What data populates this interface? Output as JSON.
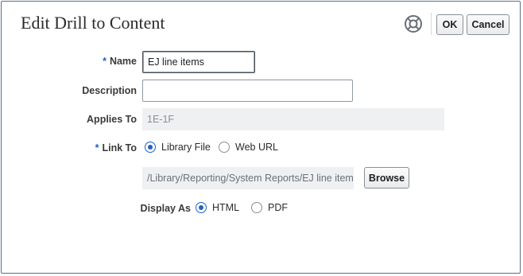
{
  "dialog": {
    "title": "Edit Drill to Content",
    "help_icon": "lifebuoy-help-icon",
    "ok_label": "OK",
    "cancel_label": "Cancel"
  },
  "form": {
    "name": {
      "label": "Name",
      "required": "*",
      "value": "EJ line items"
    },
    "description": {
      "label": "Description",
      "value": ""
    },
    "applies_to": {
      "label": "Applies To",
      "value": "1E-1F"
    },
    "link_to": {
      "label": "Link To",
      "required": "*",
      "options": [
        "Library File",
        "Web URL"
      ],
      "selected": "Library File"
    },
    "path": {
      "value": "/Library/Reporting/System Reports/EJ line items",
      "browse_label": "Browse"
    },
    "display_as": {
      "label": "Display As",
      "options": [
        "HTML",
        "PDF"
      ],
      "selected": "HTML"
    }
  },
  "colors": {
    "accent": "#1d63c2",
    "border": "#5a6f8a",
    "readonly_bg": "#eef0f2"
  }
}
